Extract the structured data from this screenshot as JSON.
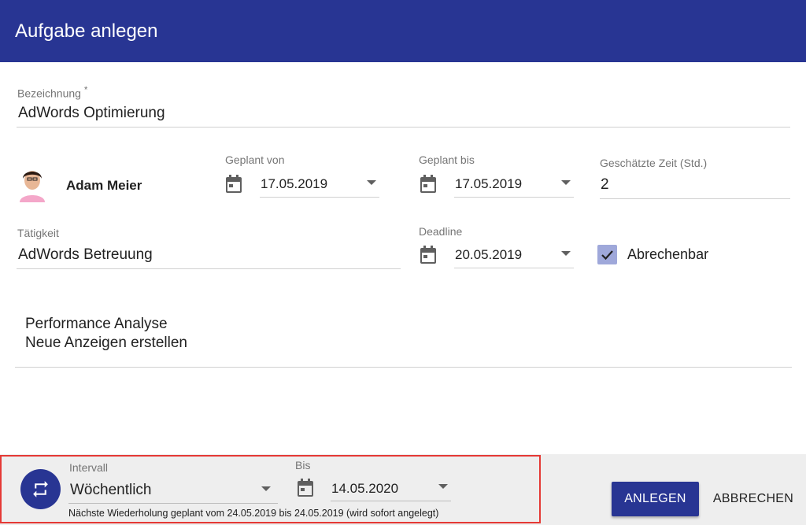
{
  "dialog": {
    "title": "Aufgabe anlegen"
  },
  "form": {
    "bezeichnung": {
      "label": "Bezeichnung",
      "required_marker": "*",
      "value": "AdWords Optimierung"
    },
    "assignee": {
      "name": "Adam Meier"
    },
    "geplant_von": {
      "label": "Geplant von",
      "value": "17.05.2019"
    },
    "geplant_bis": {
      "label": "Geplant bis",
      "value": "17.05.2019"
    },
    "geschaetzte_zeit": {
      "label": "Geschätzte Zeit (Std.)",
      "value": "2"
    },
    "taetigkeit": {
      "label": "Tätigkeit",
      "value": "AdWords Betreuung"
    },
    "deadline": {
      "label": "Deadline",
      "value": "20.05.2019"
    },
    "abrechenbar": {
      "label": "Abrechenbar",
      "checked": true
    },
    "description": "Performance Analyse\nNeue Anzeigen erstellen"
  },
  "recurrence": {
    "intervall": {
      "label": "Intervall",
      "value": "Wöchentlich"
    },
    "bis": {
      "label": "Bis",
      "value": "14.05.2020"
    },
    "hint": "Nächste Wiederholung geplant vom 24.05.2019 bis 24.05.2019 (wird sofort angelegt)"
  },
  "actions": {
    "create_label": "ANLEGEN",
    "cancel_label": "ABBRECHEN"
  },
  "colors": {
    "primary": "#283593",
    "highlight_border": "#e53935",
    "checkbox": "#9fa8da"
  },
  "icons": {
    "calendar": "calendar-icon",
    "dropdown": "caret-down-icon",
    "repeat": "repeat-icon",
    "check": "check-icon"
  }
}
